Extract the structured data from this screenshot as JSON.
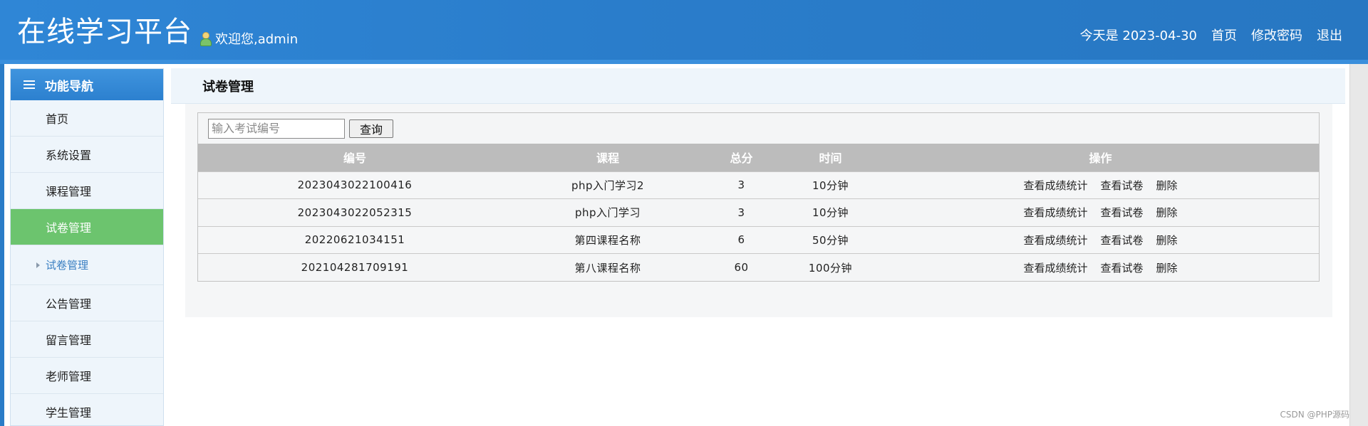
{
  "header": {
    "brand": "在线学习平台",
    "welcome": "欢迎您,admin",
    "date_text": "今天是 2023-04-30",
    "links": [
      "首页",
      "修改密码",
      "退出"
    ]
  },
  "sidebar": {
    "title": "功能导航",
    "items": [
      "首页",
      "系统设置",
      "课程管理",
      "试卷管理"
    ],
    "sub_item": "试卷管理",
    "items_after": [
      "公告管理",
      "留言管理",
      "老师管理",
      "学生管理"
    ]
  },
  "content": {
    "title": "试卷管理",
    "search": {
      "placeholder": "输入考试编号",
      "value": "",
      "button": "查询"
    },
    "columns": [
      "编号",
      "课程",
      "总分",
      "时间",
      "操作"
    ],
    "rows": [
      {
        "id": "2023043022100416",
        "course": "php入门学习2",
        "score": "3",
        "time": "10分钟"
      },
      {
        "id": "2023043022052315",
        "course": "php入门学习",
        "score": "3",
        "time": "10分钟"
      },
      {
        "id": "20220621034151",
        "course": "第四课程名称",
        "score": "6",
        "time": "50分钟"
      },
      {
        "id": "202104281709191",
        "course": "第八课程名称",
        "score": "60",
        "time": "100分钟"
      }
    ],
    "actions": [
      "查看成绩统计",
      "查看试卷",
      "删除"
    ]
  },
  "watermark": "CSDN @PHP源码",
  "colors": {
    "header_blue": "#2a7dcb",
    "active_green": "#6cc46e",
    "table_head": "#bcbcbc"
  },
  "icons": {
    "user": "user-icon",
    "nav": "list-icon",
    "sub": "triangle-right-icon"
  }
}
